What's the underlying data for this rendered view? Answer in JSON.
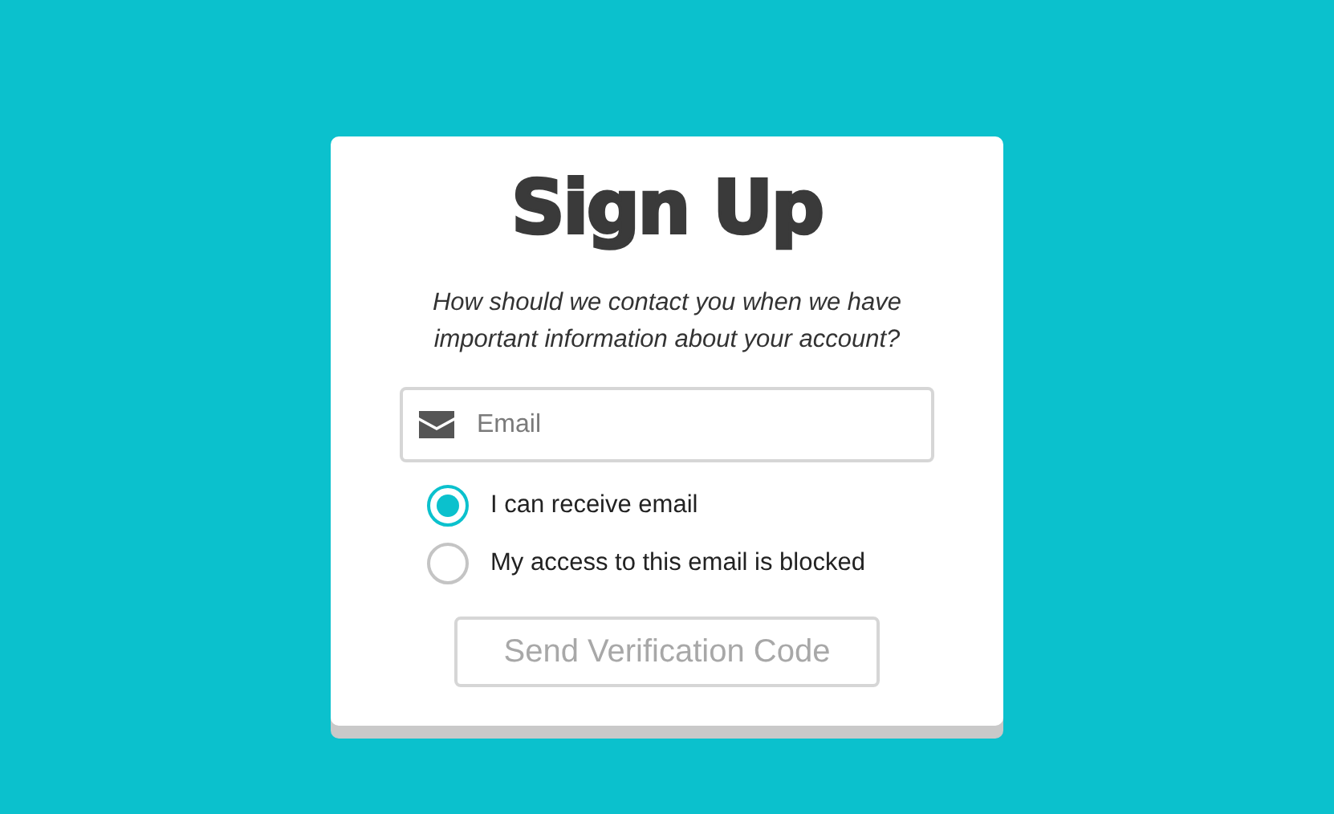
{
  "title": "Sign Up",
  "prompt": "How should we contact you when we have important information about your account?",
  "email_field": {
    "placeholder": "Email"
  },
  "options": [
    {
      "label": "I can receive email",
      "selected": true
    },
    {
      "label": "My access to this email is blocked",
      "selected": false
    }
  ],
  "submit": {
    "label": "Send Verification Code",
    "disabled": true
  }
}
